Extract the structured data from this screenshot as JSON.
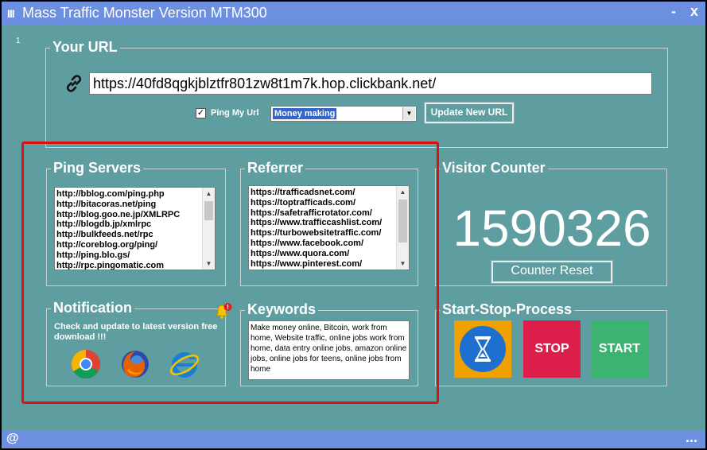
{
  "window": {
    "title": "Mass Traffic Monster Version MTM300",
    "app_icon": "III",
    "minimize_label": "-",
    "close_label": "x",
    "version_mark": "1"
  },
  "url_section": {
    "title": "Your URL",
    "url_value": "https://40fd8qgkjblztfr801zw8t1m7k.hop.clickbank.net/",
    "ping_checked": true,
    "ping_check_mark": "✓",
    "ping_label": "Ping My Url",
    "category_selected": "Money making",
    "update_button": "Update New URL"
  },
  "ping_servers": {
    "title": "Ping Servers",
    "items": [
      "http://bblog.com/ping.php",
      "http://bitacoras.net/ping",
      "http://blog.goo.ne.jp/XMLRPC",
      "http://blogdb.jp/xmlrpc",
      "http://bulkfeeds.net/rpc",
      "http://coreblog.org/ping/",
      "http://ping.blo.gs/",
      "http://rpc.pingomatic.com"
    ]
  },
  "referrer": {
    "title": "Referrer",
    "items": [
      "https://trafficadsnet.com/",
      "https://toptrafficads.com/",
      "https://safetrafficrotator.com/",
      "https://www.trafficcashlist.com/",
      "https://turbowebsitetraffic.com/",
      "https://www.facebook.com/",
      "https://www.quora.com/",
      "https://www.pinterest.com/"
    ]
  },
  "visitor_counter": {
    "title": "Visitor Counter",
    "value": "1590326",
    "reset_button": "Counter Reset"
  },
  "notification": {
    "title": "Notification",
    "message": "Check and update to latest version free download !!!",
    "badge": "!"
  },
  "keywords": {
    "title": "Keywords",
    "text": "Make money online, Bitcoin, work from home, Website traffic, online jobs work from home, data entry online jobs, amazon online jobs, online jobs for teens, online jobs from home"
  },
  "process": {
    "title": "Start-Stop-Process",
    "stop_label": "STOP",
    "start_label": "START"
  },
  "statusbar": {
    "left": "@",
    "right": "..."
  },
  "colors": {
    "background": "#5f9ea0",
    "titlebar": "#6d8fe0",
    "stop": "#dc1e4a",
    "start": "#3cb371",
    "timer": "#f0a000",
    "highlight": "#e01010"
  }
}
